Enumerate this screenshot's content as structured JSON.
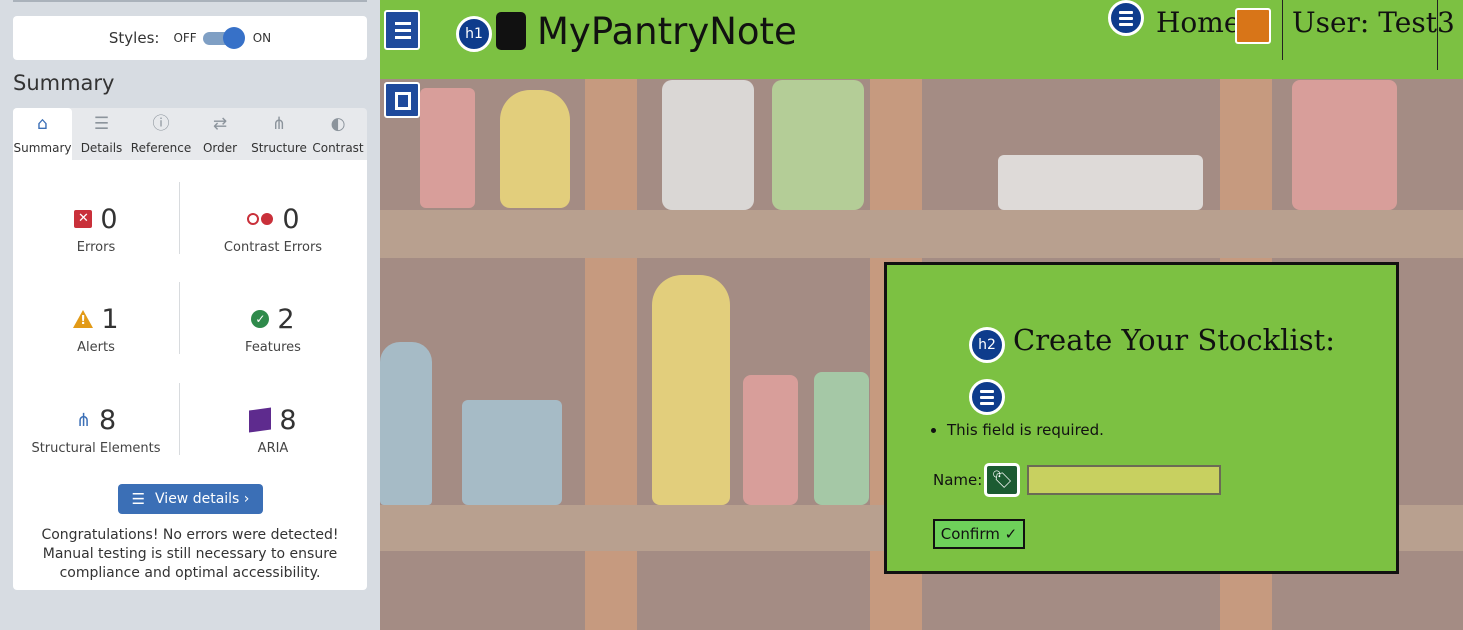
{
  "sidebar": {
    "styles_label": "Styles:",
    "toggle_off": "OFF",
    "toggle_on": "ON",
    "summary_title": "Summary",
    "tabs": [
      {
        "label": "Summary",
        "icon": "home-icon",
        "glyph": "⌂",
        "active": true
      },
      {
        "label": "Details",
        "icon": "list-icon",
        "glyph": "☰",
        "active": false
      },
      {
        "label": "Reference",
        "icon": "info-icon",
        "glyph": "ⓘ",
        "active": false
      },
      {
        "label": "Order",
        "icon": "order-icon",
        "glyph": "⇄",
        "active": false
      },
      {
        "label": "Structure",
        "icon": "structure-icon",
        "glyph": "⋔",
        "active": false
      },
      {
        "label": "Contrast",
        "icon": "contrast-icon",
        "glyph": "◐",
        "active": false
      }
    ],
    "stats": {
      "errors": {
        "value": "0",
        "label": "Errors"
      },
      "contrast_errors": {
        "value": "0",
        "label": "Contrast Errors"
      },
      "alerts": {
        "value": "1",
        "label": "Alerts"
      },
      "features": {
        "value": "2",
        "label": "Features"
      },
      "structural": {
        "value": "8",
        "label": "Structural Elements"
      },
      "aria": {
        "value": "8",
        "label": "ARIA"
      }
    },
    "view_details": "View details ›",
    "congrats": "Congratulations! No errors were detected! Manual testing is still necessary to ensure compliance and optimal accessibility."
  },
  "page": {
    "h1_badge": "h1",
    "site_title": "MyPantryNote",
    "nav_home": "Home",
    "nav_user": "User: Test3",
    "form": {
      "h2_badge": "h2",
      "heading": "Create Your Stocklist:",
      "error_item": "This field is required.",
      "name_label": "Name:",
      "name_value": "",
      "confirm": "Confirm ✓"
    }
  },
  "colors": {
    "header_green": "#7cc142",
    "wave_blue": "#3b6fb6",
    "error_red": "#c9303a",
    "alert_orange": "#e29a17",
    "feature_green": "#2f8a4b",
    "aria_purple": "#5e2b8e"
  }
}
